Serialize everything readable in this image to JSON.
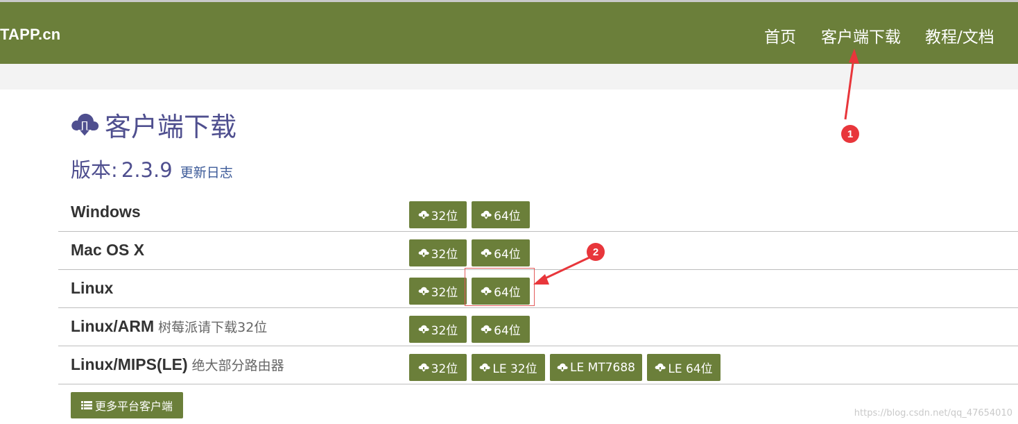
{
  "navbar": {
    "brand": "TAPP.cn",
    "items": [
      {
        "label": "首页"
      },
      {
        "label": "客户端下载"
      },
      {
        "label": "教程/文档"
      }
    ],
    "color": "#6b7f3a"
  },
  "header": {
    "title": "客户端下载",
    "icon": "cloud-download-icon"
  },
  "version": {
    "label": "版本:",
    "number": "2.3.9",
    "changelog": "更新日志"
  },
  "platforms": [
    {
      "name": "Windows",
      "note": "",
      "buttons": [
        "32位",
        "64位"
      ]
    },
    {
      "name": "Mac OS X",
      "note": "",
      "buttons": [
        "32位",
        "64位"
      ]
    },
    {
      "name": "Linux",
      "note": "",
      "buttons": [
        "32位",
        "64位"
      ]
    },
    {
      "name": "Linux/ARM",
      "note": "树莓派请下载32位",
      "buttons": [
        "32位",
        "64位"
      ]
    },
    {
      "name": "Linux/MIPS(LE)",
      "note": "绝大部分路由器",
      "buttons": [
        "32位",
        "LE 32位",
        "LE MT7688",
        "LE 64位"
      ]
    }
  ],
  "more_button": {
    "label": "更多平台客户端",
    "icon": "list-icon"
  },
  "annotations": [
    {
      "label": "1",
      "color": "#e8363b"
    },
    {
      "label": "2",
      "color": "#e8363b"
    }
  ],
  "watermark": "https://blog.csdn.net/qq_47654010"
}
